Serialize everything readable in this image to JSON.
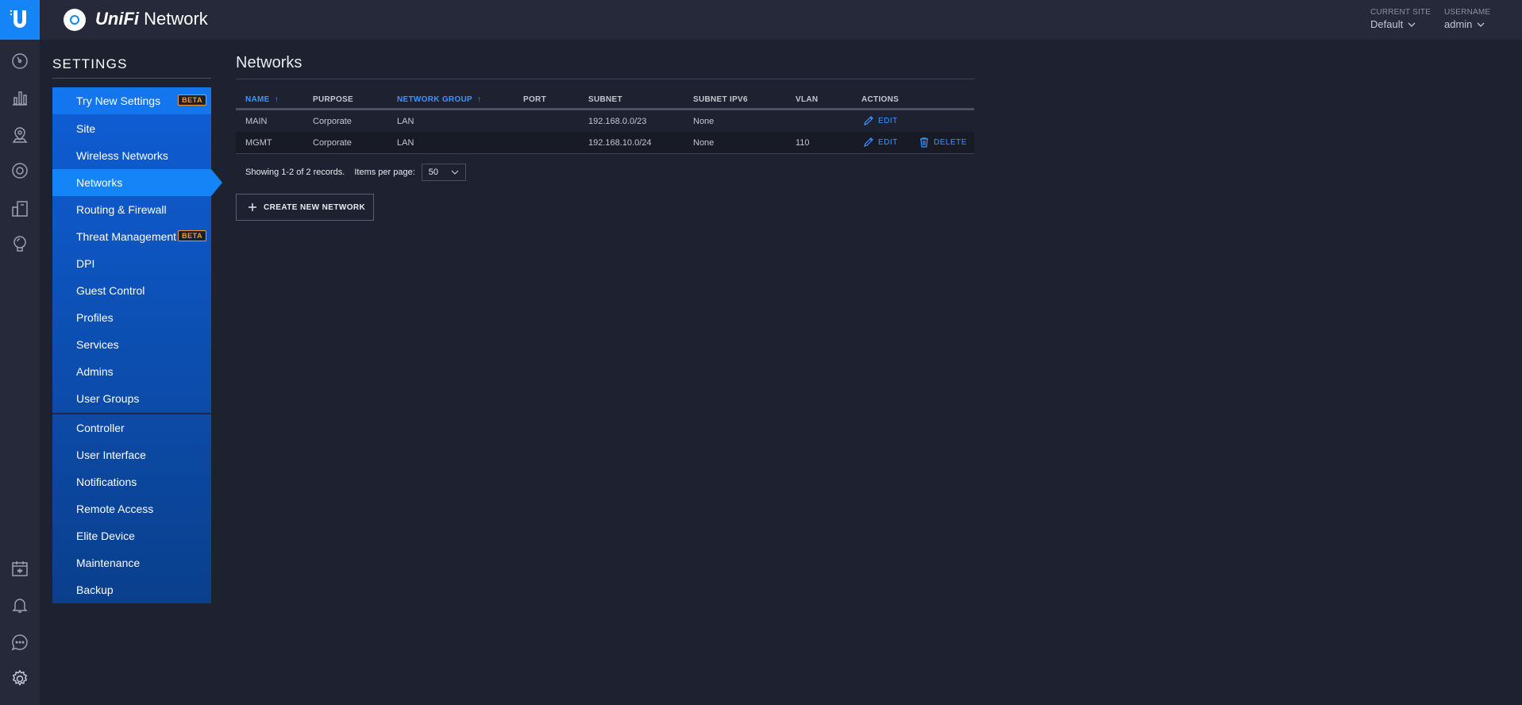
{
  "app": {
    "brand_unifi": "UniFi",
    "brand_network": "Network"
  },
  "header": {
    "site_label": "CURRENT SITE",
    "site_value": "Default",
    "user_label": "USERNAME",
    "user_value": "admin"
  },
  "rail": {
    "icons": [
      "dashboard-icon",
      "statistics-icon",
      "map-icon",
      "devices-icon",
      "clients-icon",
      "insights-icon",
      "events-icon",
      "alerts-icon",
      "chat-icon",
      "settings-icon"
    ]
  },
  "settings": {
    "title": "SETTINGS",
    "beta_label": "BETA",
    "try_new": "Try New Settings",
    "items": [
      "Site",
      "Wireless Networks",
      "Networks",
      "Routing & Firewall",
      "Threat Management",
      "DPI",
      "Guest Control",
      "Profiles",
      "Services",
      "Admins",
      "User Groups"
    ],
    "items2": [
      "Controller",
      "User Interface",
      "Notifications",
      "Remote Access",
      "Elite Device",
      "Maintenance",
      "Backup"
    ],
    "active": "Networks"
  },
  "main": {
    "title": "Networks",
    "columns": [
      "NAME",
      "PURPOSE",
      "NETWORK GROUP",
      "PORT",
      "SUBNET",
      "SUBNET IPV6",
      "VLAN",
      "ACTIONS"
    ],
    "rows": [
      {
        "name": "MAIN",
        "purpose": "Corporate",
        "group": "LAN",
        "port": "",
        "subnet": "192.168.0.0/23",
        "ipv6": "None",
        "vlan": ""
      },
      {
        "name": "MGMT",
        "purpose": "Corporate",
        "group": "LAN",
        "port": "",
        "subnet": "192.168.10.0/24",
        "ipv6": "None",
        "vlan": "110"
      }
    ],
    "edit_label": "EDIT",
    "delete_label": "DELETE",
    "pager_text": "Showing 1-2 of 2 records.",
    "items_per_page_label": "Items per page:",
    "items_per_page_value": "50",
    "create_label": "CREATE NEW NETWORK"
  },
  "colors": {
    "accent": "#1484f7",
    "sorted": "#3b95ff",
    "beta": "#f39a2b",
    "background": "#1e2130"
  }
}
